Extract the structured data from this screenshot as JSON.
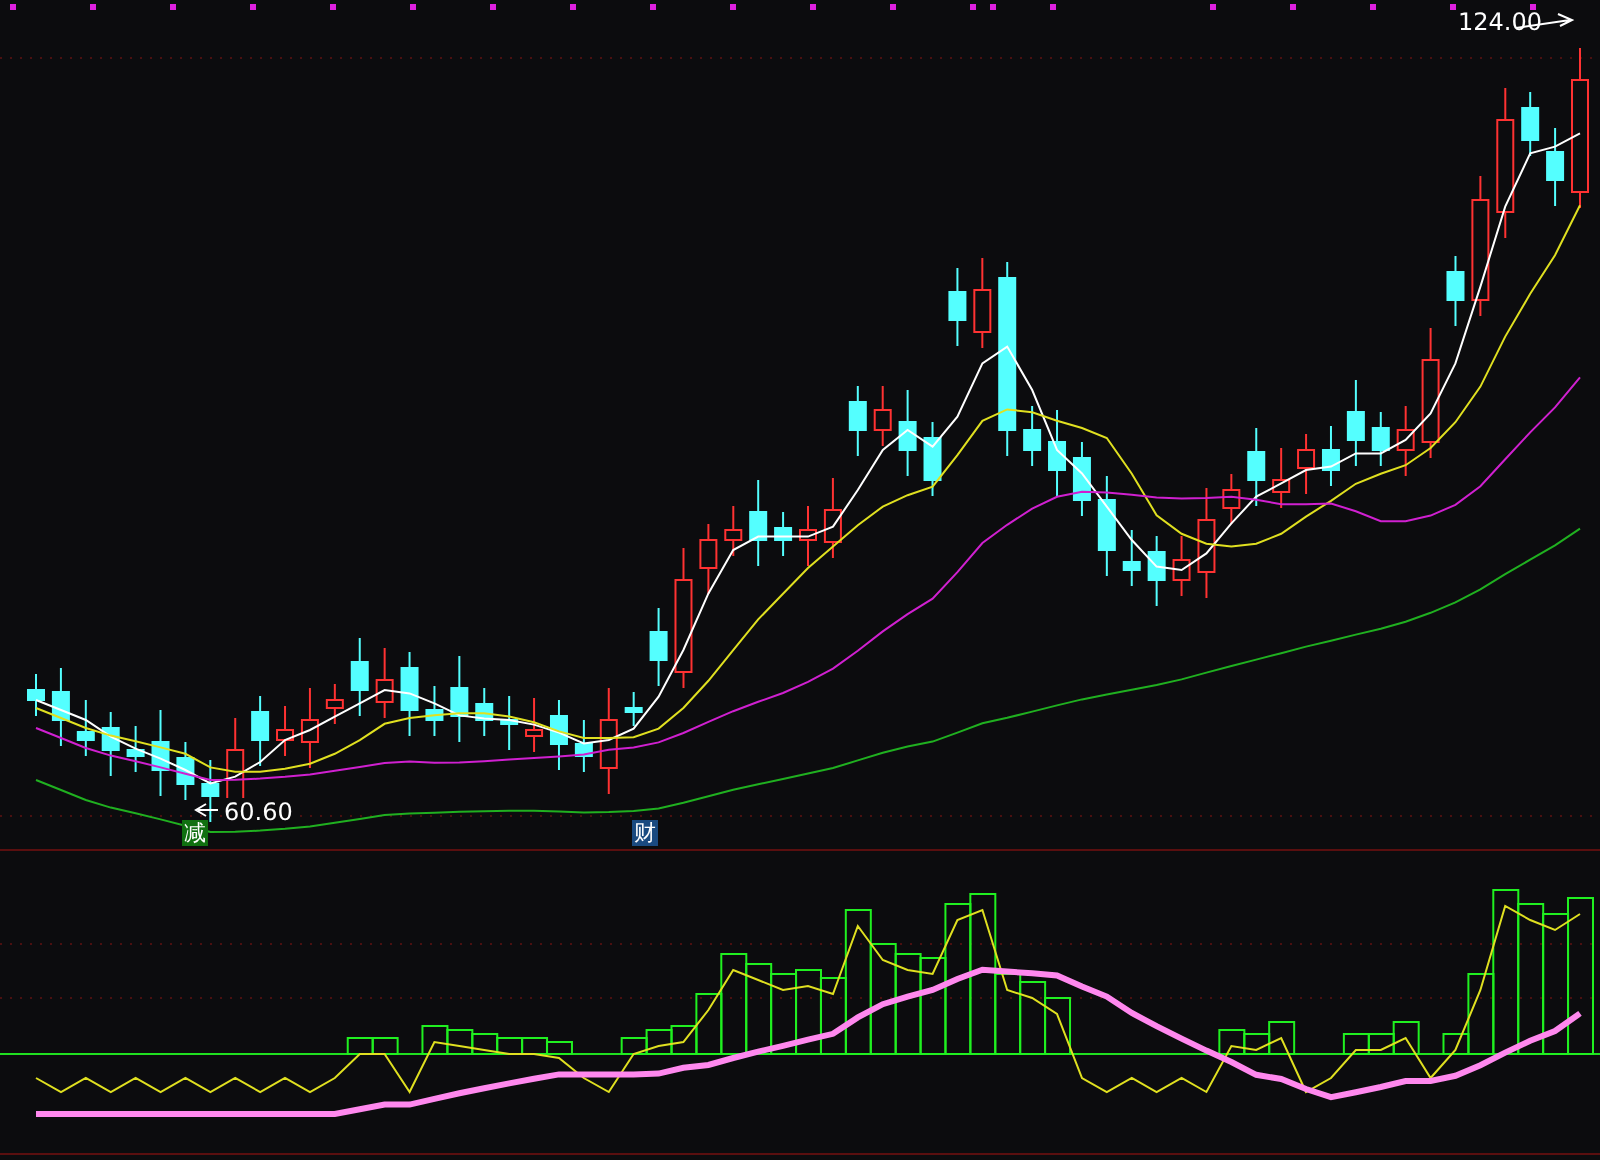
{
  "price_high": {
    "label": "124.00"
  },
  "price_low": {
    "label": "60.60"
  },
  "event_markers": [
    {
      "label": "减",
      "kind": "reduction"
    },
    {
      "label": "财",
      "kind": "finance"
    }
  ]
}
